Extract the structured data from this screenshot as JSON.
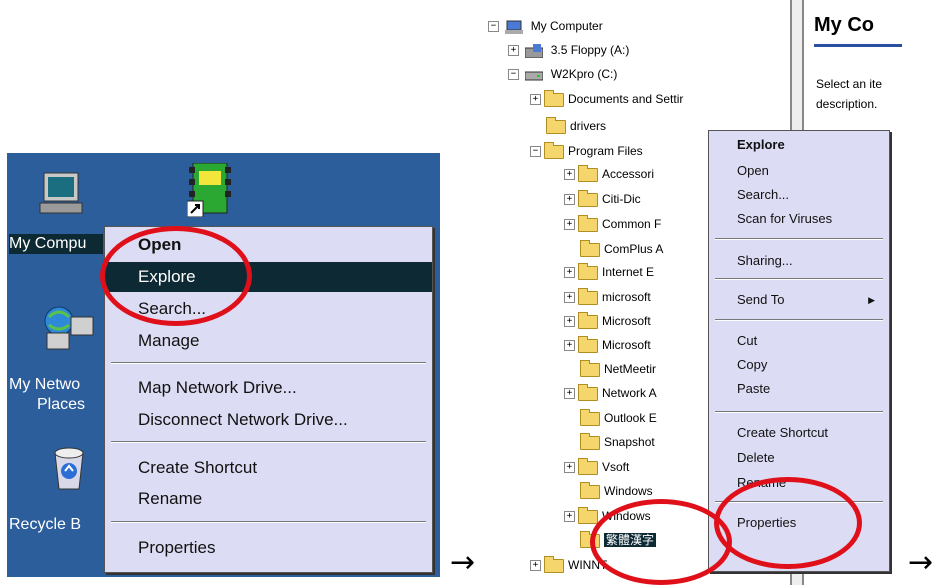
{
  "desktop": {
    "icons": [
      {
        "label": "My Compu"
      },
      {
        "label": "My Netwo"
      },
      {
        "label": "Places"
      },
      {
        "label": "Recycle B"
      }
    ],
    "context_menu": [
      {
        "label": "Open"
      },
      {
        "label": "Explore"
      },
      {
        "label": "Search..."
      },
      {
        "label": "Manage"
      },
      {
        "label": "Map Network Drive..."
      },
      {
        "label": "Disconnect Network Drive..."
      },
      {
        "label": "Create Shortcut"
      },
      {
        "label": "Rename"
      },
      {
        "label": "Properties"
      }
    ]
  },
  "explorer": {
    "header_title": "My Co",
    "description_lines": [
      "Select an ite",
      "description."
    ],
    "tree": [
      {
        "label": "My Computer"
      },
      {
        "label": "3.5 Floppy (A:)"
      },
      {
        "label": "W2Kpro (C:)"
      },
      {
        "label": "Documents and Settir"
      },
      {
        "label": "drivers"
      },
      {
        "label": "Program Files"
      },
      {
        "label": "Accessori"
      },
      {
        "label": "Citi-Dic"
      },
      {
        "label": "Common F"
      },
      {
        "label": "ComPlus A"
      },
      {
        "label": "Internet E"
      },
      {
        "label": "microsoft"
      },
      {
        "label": "Microsoft"
      },
      {
        "label": "Microsoft"
      },
      {
        "label": "NetMeetir"
      },
      {
        "label": "Network A"
      },
      {
        "label": "Outlook E"
      },
      {
        "label": "Snapshot"
      },
      {
        "label": "Vsoft"
      },
      {
        "label": "Windows"
      },
      {
        "label": "Windows"
      },
      {
        "label": "繁體漢字"
      },
      {
        "label": "WINNT"
      }
    ],
    "context_menu": [
      {
        "label": "Explore"
      },
      {
        "label": "Open"
      },
      {
        "label": "Search..."
      },
      {
        "label": "Scan for Viruses"
      },
      {
        "label": "Sharing..."
      },
      {
        "label": "Send To"
      },
      {
        "label": "Cut"
      },
      {
        "label": "Copy"
      },
      {
        "label": "Paste"
      },
      {
        "label": "Create Shortcut"
      },
      {
        "label": "Delete"
      },
      {
        "label": "Rename"
      },
      {
        "label": "Properties"
      }
    ],
    "submenu_arrow": "▶"
  },
  "arrows": [
    "→",
    "→"
  ],
  "colors": {
    "desktop_bg": "#2d5e9c",
    "menu_bg": "#dcdcf4",
    "highlight": "#0d2a34",
    "ring": "#e0101a"
  }
}
